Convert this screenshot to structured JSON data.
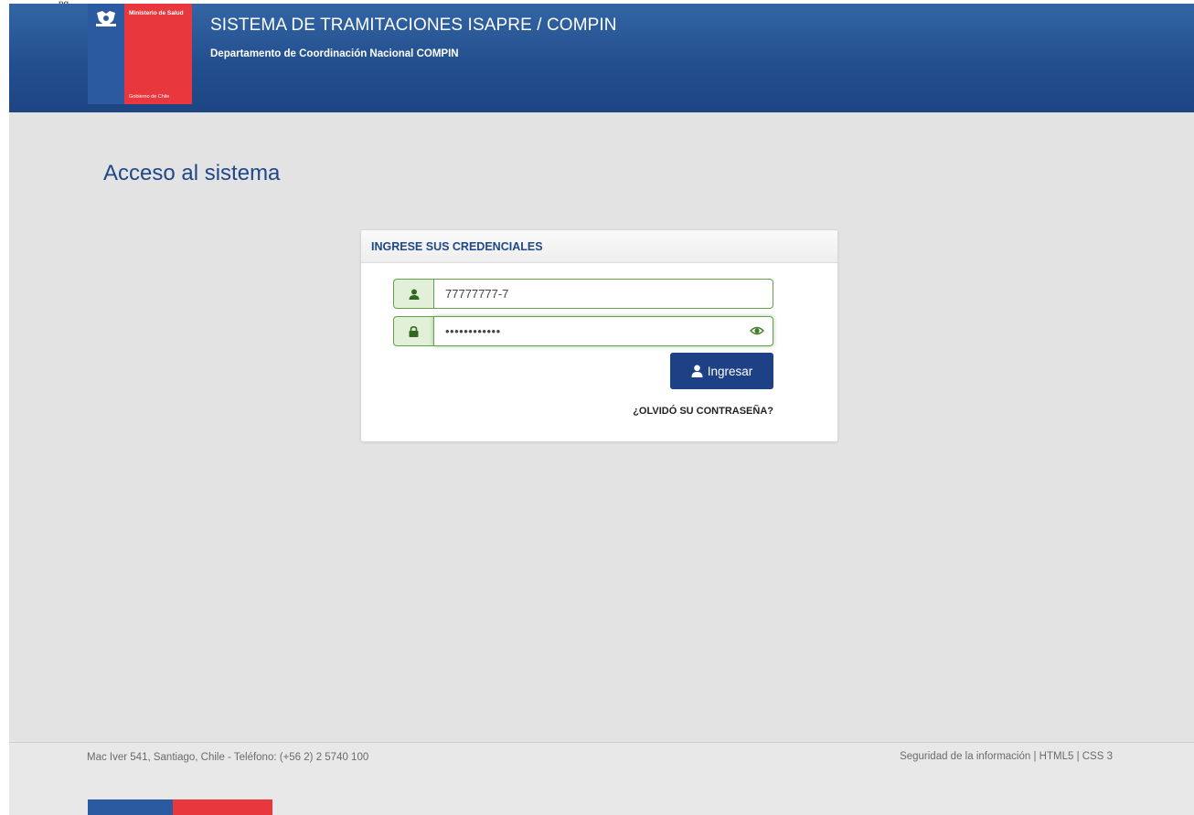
{
  "top_sliver": {
    "mark": "ng"
  },
  "header": {
    "title": "SISTEMA DE TRAMITACIONES ISAPRE / COMPIN",
    "subtitle": "Departamento de Coordinación Nacional COMPIN",
    "logo": {
      "top_text": "Ministerio de Salud",
      "bottom_text": "Gobierno de Chile",
      "colors": {
        "blue": "#2c5aa0",
        "red": "#e8383d"
      }
    }
  },
  "main": {
    "page_title": "Acceso al sistema"
  },
  "login_card": {
    "header": "INGRESE SUS CREDENCIALES",
    "username": {
      "value": "77777777-7",
      "icon": "user-icon"
    },
    "password": {
      "value": "••••••••••••",
      "icon": "lock-icon",
      "toggle_icon": "eye-icon"
    },
    "submit": {
      "label": "Ingresar",
      "icon": "user-icon"
    },
    "forgot_link": "¿OLVIDÓ SU CONTRASEÑA?"
  },
  "footer": {
    "address": "Mac Iver 541, Santiago, Chile - Teléfono: (+56 2) 2 5740 100",
    "links": [
      "Seguridad de la información",
      "HTML5",
      "CSS 3"
    ],
    "separator": "|"
  },
  "colors": {
    "header_bg": "#234f8e",
    "primary_text": "#1e4888",
    "button_bg": "#1e4085",
    "input_border": "#62a04a",
    "input_addon_bg": "#e2f0d9",
    "page_bg": "#e3e3e3"
  }
}
